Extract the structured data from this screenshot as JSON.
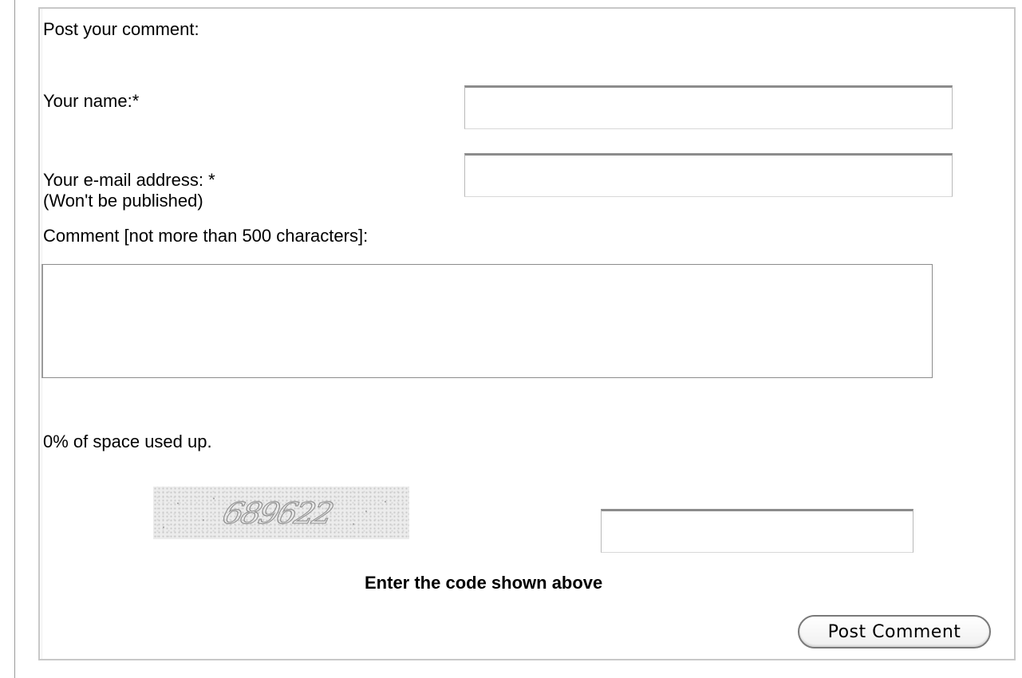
{
  "form": {
    "heading": "Post your comment:",
    "name_label": "Your name:*",
    "name_value": "",
    "email_label": "Your e-mail address: *",
    "email_note": "(Won't be published)",
    "email_value": "",
    "comment_label": "Comment [not more than 500 characters]:",
    "comment_value": "",
    "space_used_text": "0% of space used up.",
    "space_used_percent": 0,
    "captcha_code": "689622",
    "captcha_value": "",
    "captcha_hint": "Enter the code shown above",
    "submit_label": "Post Comment"
  },
  "colors": {
    "border": "#c8c8c8",
    "input_border_top": "#8c8c8c",
    "text": "#000000"
  }
}
